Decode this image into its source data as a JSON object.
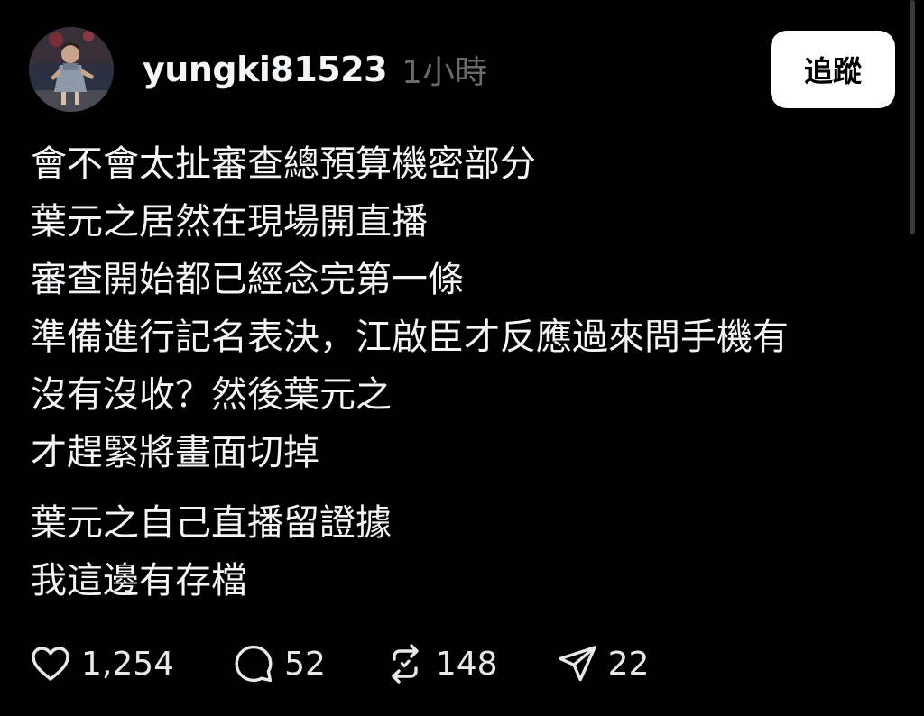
{
  "post": {
    "username": "yungki81523",
    "timestamp": "1小時",
    "follow_label": "追蹤",
    "avatar_icon": "user-avatar-photo",
    "paragraphs": [
      {
        "lines": [
          "會不會太扯審查總預算機密部分",
          "葉元之居然在現場開直播",
          "審查開始都已經念完第一條",
          "準備進行記名表決，江啟臣才反應過來問手機有",
          "沒有沒收？然後葉元之",
          "才趕緊將畫面切掉"
        ]
      },
      {
        "lines": [
          "葉元之自己直播留證據",
          "我這邊有存檔"
        ]
      }
    ],
    "actions": {
      "like": {
        "icon": "heart-icon",
        "count": "1,254"
      },
      "reply": {
        "icon": "comment-icon",
        "count": "52"
      },
      "repost": {
        "icon": "repost-icon",
        "count": "148"
      },
      "share": {
        "icon": "send-icon",
        "count": "22"
      }
    }
  },
  "colors": {
    "background": "#000000",
    "text": "#f3f5f7",
    "muted": "#6a6a6a",
    "button_bg": "#ffffff",
    "button_text": "#000000"
  }
}
